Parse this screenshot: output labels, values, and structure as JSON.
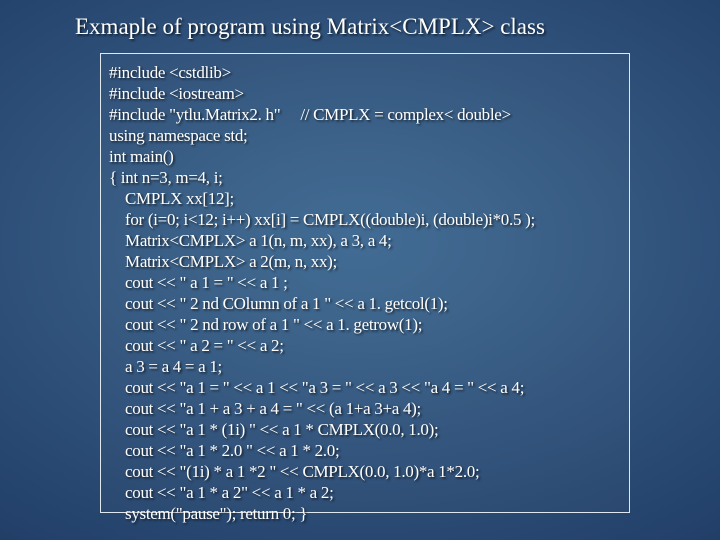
{
  "title": "Exmaple of program using Matrix<CMPLX> class",
  "code": {
    "l1": "#include <cstdlib>",
    "l2": "#include <iostream>",
    "l3a": "#include \"ytlu.Matrix2. h\"",
    "l3b": "// CMPLX = complex< double>",
    "l4": "using namespace std;",
    "l5": "int main()",
    "l6": "{ int n=3, m=4, i;",
    "l7": "CMPLX xx[12];",
    "l8": "for (i=0; i<12; i++) xx[i] = CMPLX((double)i, (double)i*0.5 );",
    "l9": "Matrix<CMPLX> a 1(n, m, xx), a 3, a 4;",
    "l10": "Matrix<CMPLX> a 2(m, n, xx);",
    "l11": "cout << \" a 1 = \" << a 1 ;",
    "l12": "cout << \" 2 nd COlumn of a 1 \" << a 1. getcol(1);",
    "l13": "cout << \" 2 nd row of a 1 \" << a 1. getrow(1);",
    "l14": "cout << \" a 2 = \" << a 2;",
    "l15": "a 3 = a 4 = a 1;",
    "l16": "cout << \"a 1 = \" << a 1 << \"a 3 = \" << a 3 << \"a 4 = \" << a 4;",
    "l17": "cout << \"a 1 + a 3 + a 4 = \" << (a 1+a 3+a 4);",
    "l18": "cout << \"a 1 * (1i) \" << a 1 * CMPLX(0.0, 1.0);",
    "l19": "cout << \"a 1 * 2.0 \" << a 1 * 2.0;",
    "l20": "cout << \"(1i) * a 1 *2 \" << CMPLX(0.0, 1.0)*a 1*2.0;",
    "l21": "cout << \"a 1 * a 2\" << a 1 * a 2;",
    "l22": "system(\"pause\");  return 0; }"
  }
}
